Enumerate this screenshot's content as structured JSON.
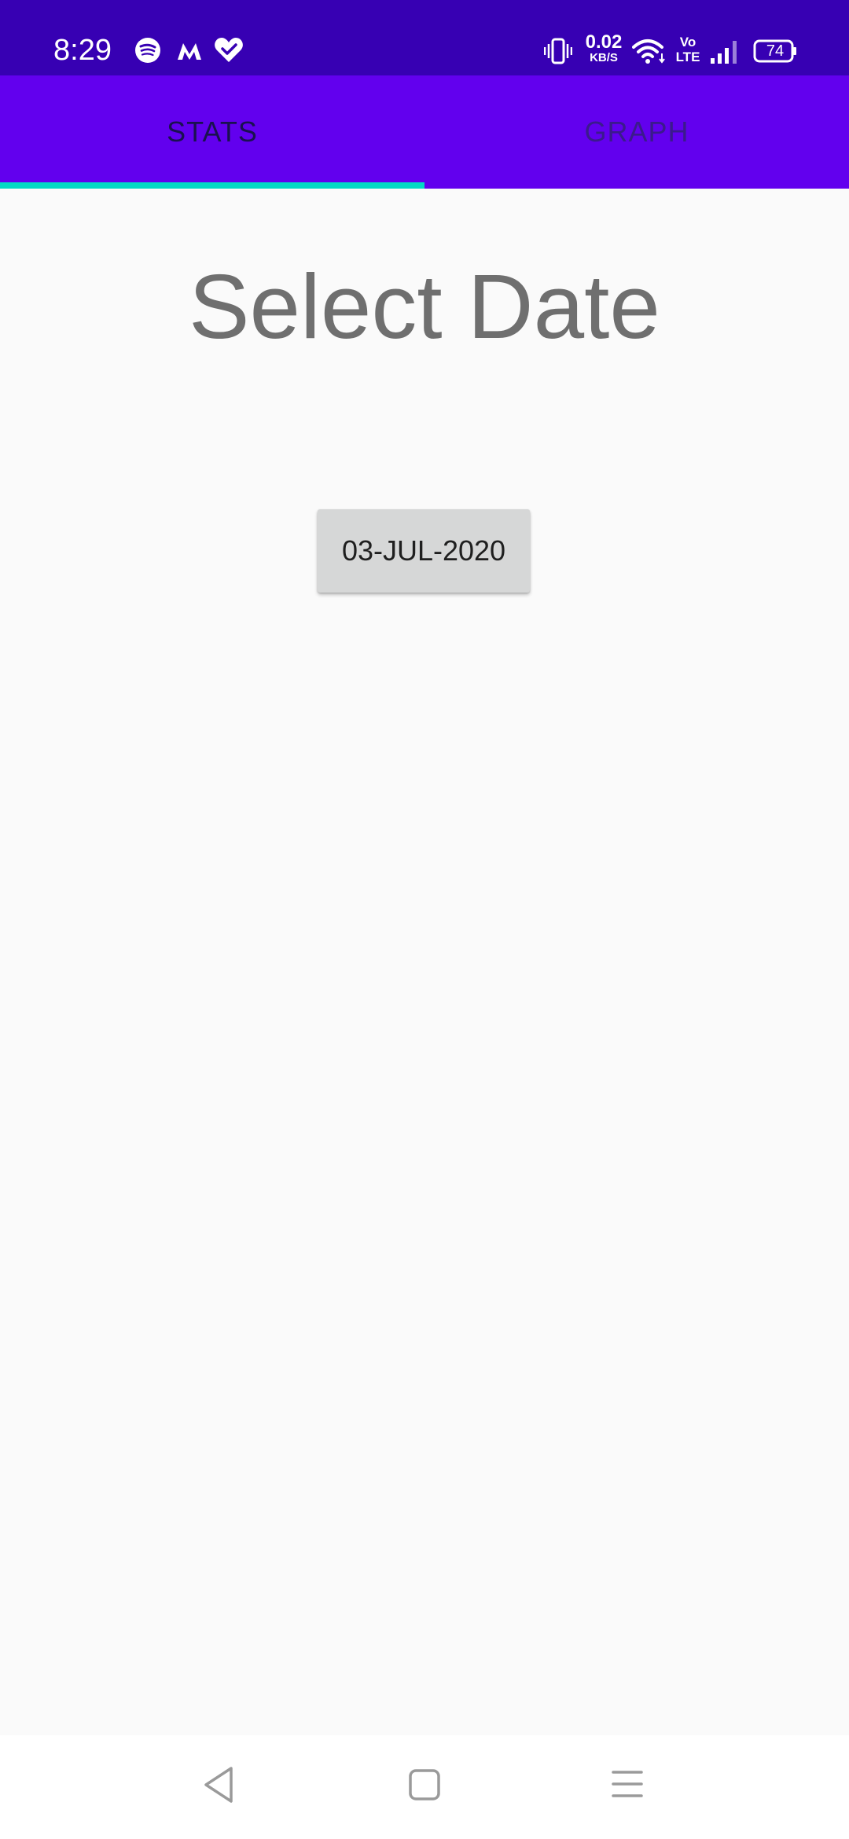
{
  "status_bar": {
    "time": "8:29",
    "notification_icons": [
      "spotify-icon",
      "myntra-icon",
      "health-heart-icon"
    ],
    "net_speed_value": "0.02",
    "net_speed_unit": "KB/S",
    "volte_top": "Vo",
    "volte_bottom": "LTE",
    "battery_level": "74",
    "background_color": "#3700b3"
  },
  "tabs": [
    {
      "label": "STATS",
      "selected": true
    },
    {
      "label": "GRAPH",
      "selected": false
    }
  ],
  "colors": {
    "tab_bar": "#6200ee",
    "indicator": "#03dac5",
    "page_background": "#fafafa",
    "title_text": "#6f6f6f",
    "button_background": "#d6d7d7"
  },
  "main": {
    "title": "Select Date",
    "date_button_label": "03-JUL-2020"
  },
  "nav_bar": {
    "buttons": [
      "back-icon",
      "home-icon",
      "recents-menu-icon"
    ]
  }
}
